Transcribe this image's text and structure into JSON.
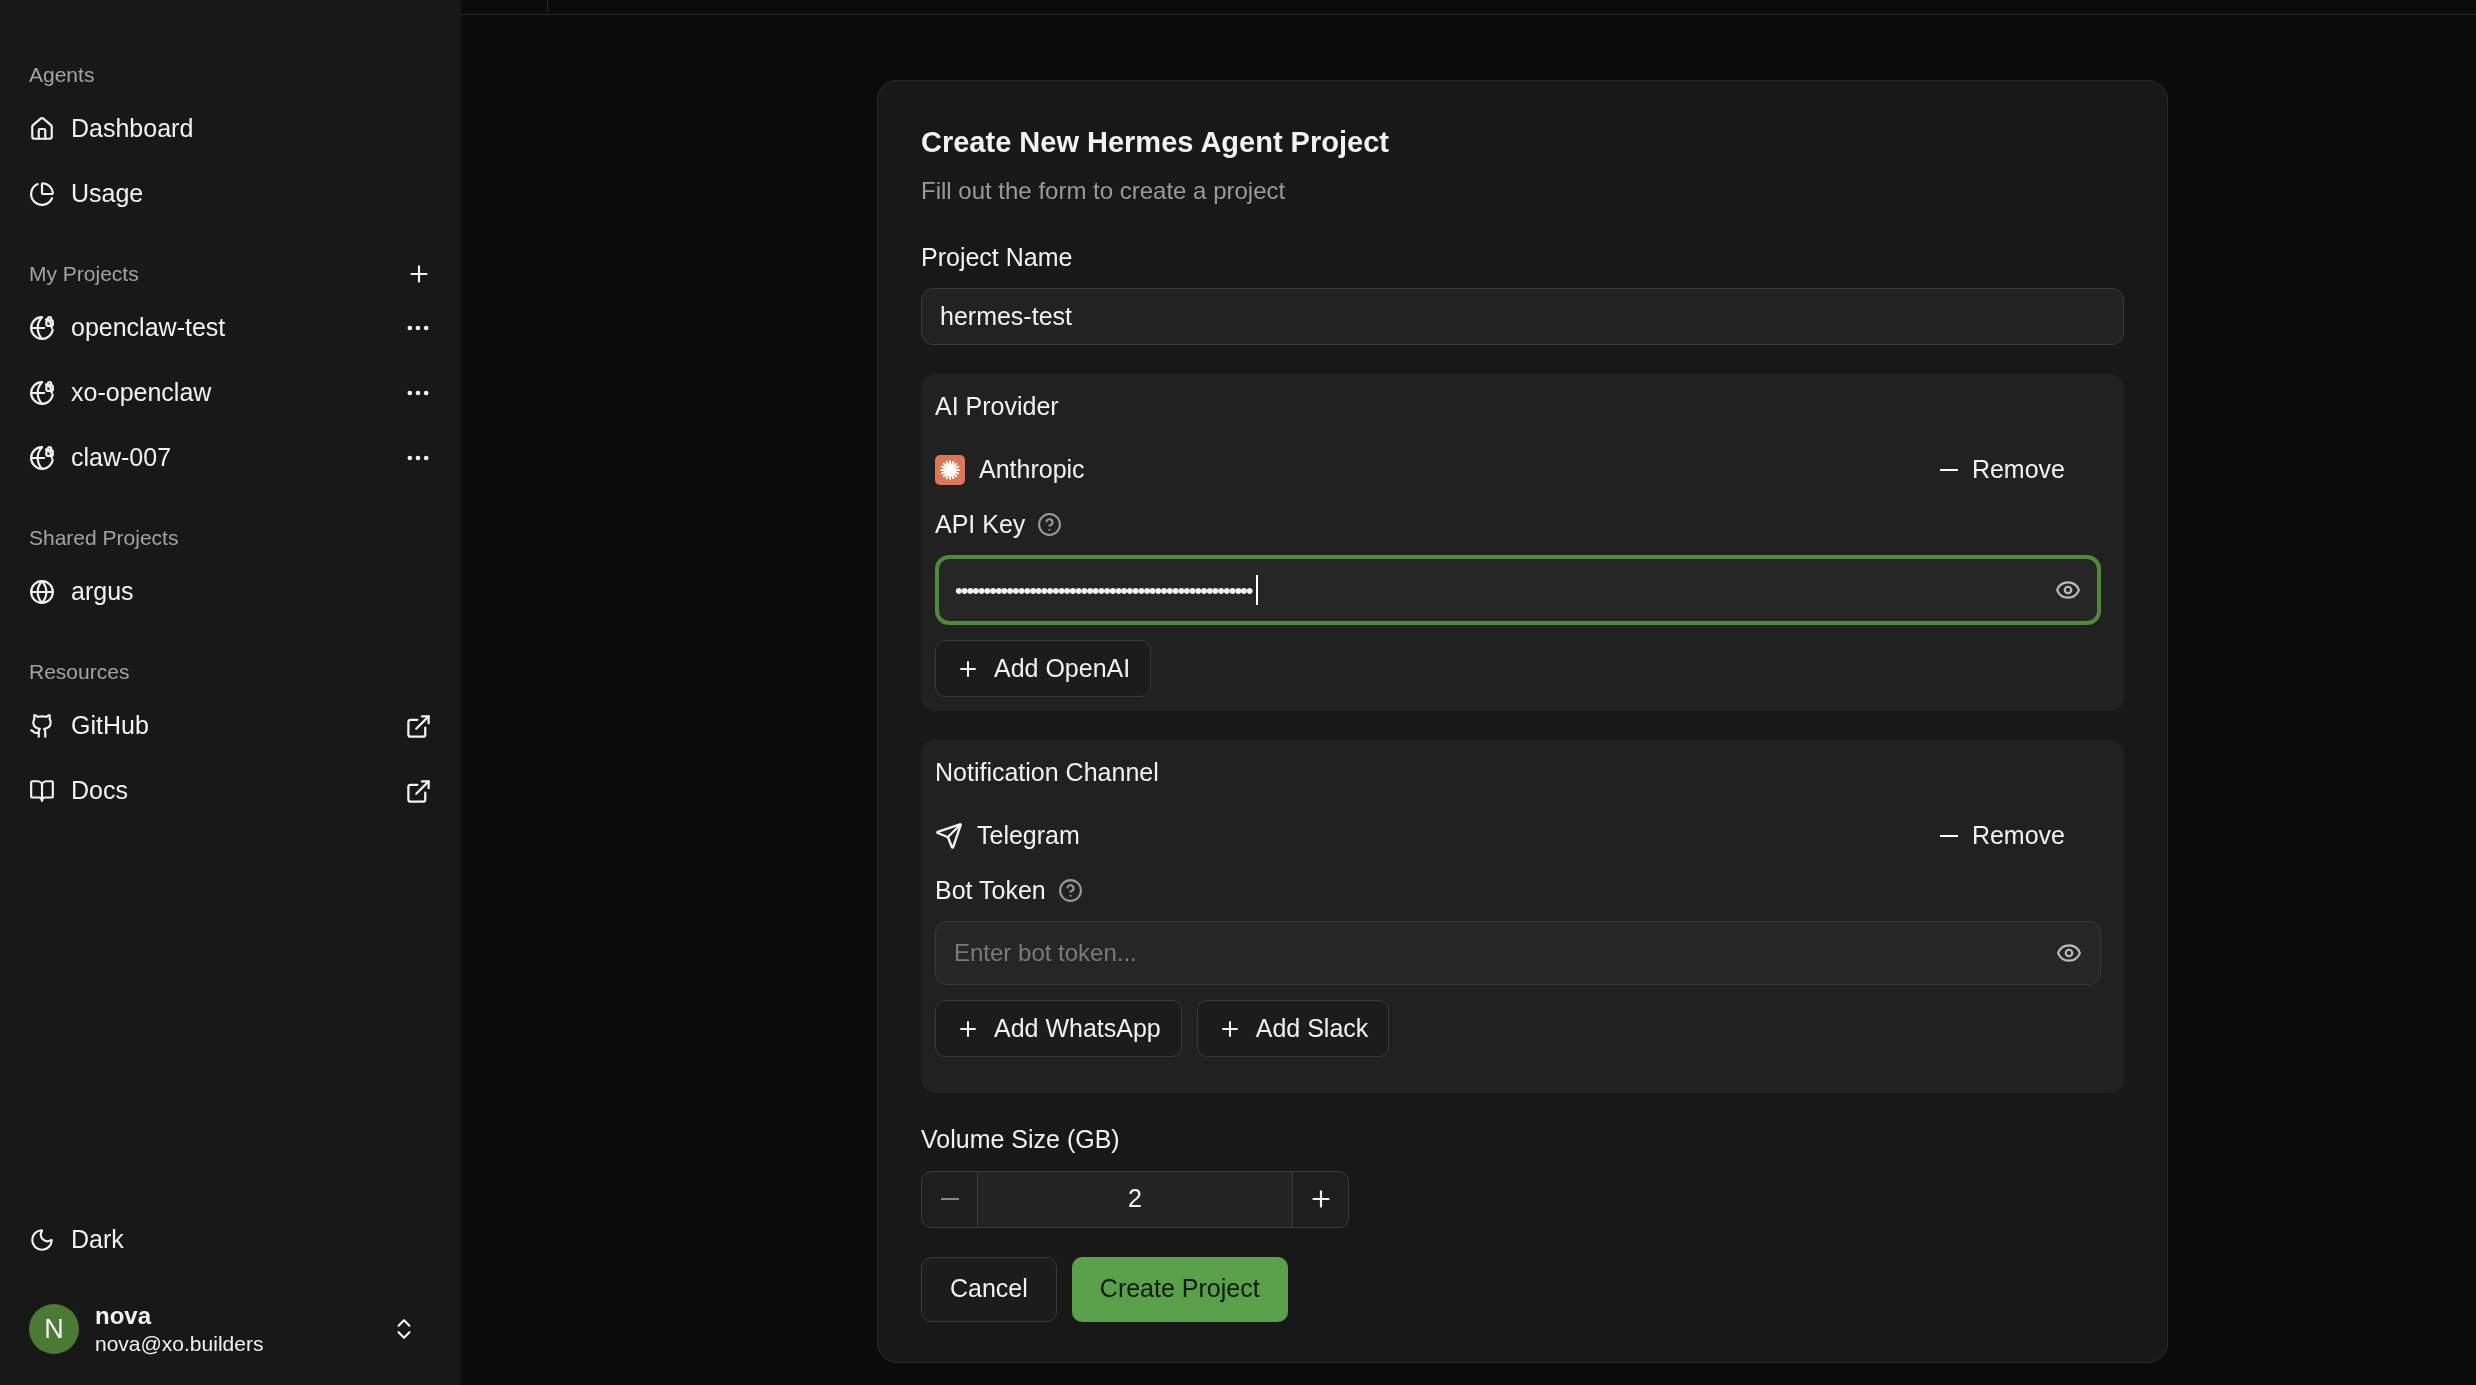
{
  "sidebar": {
    "sections": [
      {
        "title": "Agents",
        "action": false,
        "items": [
          {
            "kind": "nav",
            "label": "Dashboard"
          },
          {
            "kind": "nav",
            "label": "Usage"
          }
        ]
      },
      {
        "title": "My Projects",
        "action": true,
        "items": [
          {
            "kind": "project",
            "label": "openclaw-test",
            "menu": true
          },
          {
            "kind": "project",
            "label": "xo-openclaw",
            "menu": true
          },
          {
            "kind": "project",
            "label": "claw-007",
            "menu": true
          }
        ]
      },
      {
        "title": "Shared Projects",
        "action": false,
        "items": [
          {
            "kind": "shared",
            "label": "argus"
          }
        ]
      },
      {
        "title": "Resources",
        "action": false,
        "items": [
          {
            "kind": "resource",
            "label": "GitHub",
            "external": true
          },
          {
            "kind": "resource",
            "label": "Docs",
            "external": true
          }
        ]
      }
    ],
    "theme": {
      "label": "Dark"
    },
    "user": {
      "initial": "N",
      "name": "nova",
      "email": "nova@xo.builders"
    }
  },
  "form": {
    "title": "Create New Hermes Agent Project",
    "subtitle": "Fill out the form to create a project",
    "project_name": {
      "label": "Project Name",
      "value": "hermes-test"
    },
    "groups": [
      {
        "title": "AI Provider",
        "item": {
          "name": "Anthropic",
          "remove": "Remove"
        },
        "field": {
          "label": "API Key",
          "value": "••••••••••••••••••••••••••••••••••••••••••••••••••••",
          "focused": true
        },
        "add_buttons": [
          "Add OpenAI"
        ]
      },
      {
        "title": "Notification Channel",
        "item": {
          "name": "Telegram",
          "remove": "Remove"
        },
        "field": {
          "label": "Bot Token",
          "placeholder": "Enter bot token...",
          "focused": false
        },
        "add_buttons": [
          "Add WhatsApp",
          "Add Slack"
        ]
      }
    ],
    "volume": {
      "label": "Volume Size (GB)",
      "value": "2"
    },
    "buttons": [
      {
        "kind": "secondary",
        "label": "Cancel"
      },
      {
        "kind": "primary",
        "label": "Create Project"
      }
    ]
  }
}
